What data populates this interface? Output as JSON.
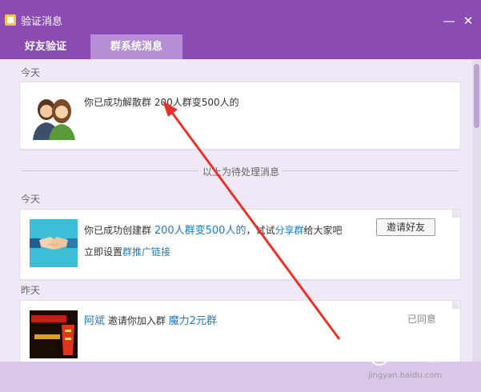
{
  "window": {
    "title": "验证消息",
    "accent": "#8a4bb3"
  },
  "tabs": [
    {
      "label": "好友验证",
      "active": false
    },
    {
      "label": "群系统消息",
      "active": true
    }
  ],
  "sections": {
    "today_1": "今天",
    "divider": "以上为待处理消息",
    "today_2": "今天",
    "yesterday": "昨天"
  },
  "card1": {
    "text_prefix": "你已成功解散群 ",
    "group_name": "200人群变500人的"
  },
  "card2": {
    "text_prefix": "你已成功创建群 ",
    "group_name": "200人群变500人的",
    "text_middle": "，试试",
    "share_link": "分享群",
    "text_suffix": "给大家吧",
    "invite_button": "邀请好友",
    "set_prefix": "立即设置",
    "promo_link": "群推广链接"
  },
  "card3": {
    "user": "阿斌",
    "text_middle": " 邀请你加入群 ",
    "group_name": "魔力2元群",
    "status": "已同意"
  },
  "watermark": {
    "text": "Baidu经验",
    "url": "jingyan.baidu.com"
  }
}
